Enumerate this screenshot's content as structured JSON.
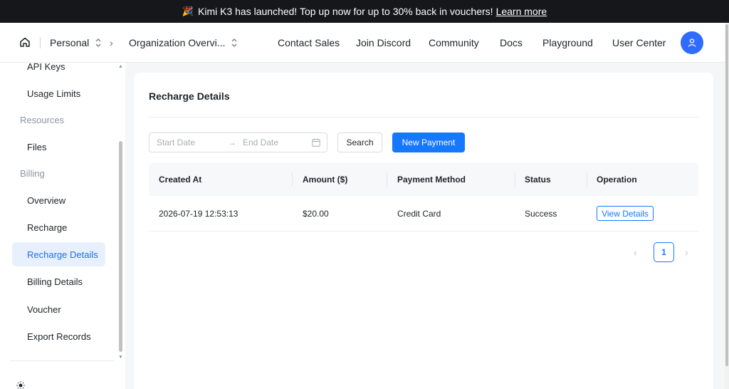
{
  "banner": {
    "emoji": "🎉",
    "message": "Kimi K3 has launched! Top up now for up to 30% back in vouchers!",
    "link_label": "Learn more"
  },
  "topnav": {
    "workspace": "Personal",
    "organization": "Organization Overvi...",
    "links": [
      "Contact Sales",
      "Join Discord",
      "Community",
      "Docs",
      "Playground",
      "User Center"
    ]
  },
  "sidebar": {
    "items_top": [
      "API Keys",
      "Usage Limits"
    ],
    "groups": [
      "Resources",
      "Billing"
    ],
    "resources_items": [
      "Files"
    ],
    "billing_items": [
      "Overview",
      "Recharge",
      "Recharge Details",
      "Billing Details",
      "Voucher",
      "Export Records"
    ],
    "active_item": "Recharge Details"
  },
  "main": {
    "title": "Recharge Details",
    "filters": {
      "start_placeholder": "Start Date",
      "arrow": "→",
      "end_placeholder": "End Date",
      "search_label": "Search",
      "new_payment_label": "New Payment"
    },
    "table": {
      "columns": [
        "Created At",
        "Amount ($)",
        "Payment Method",
        "Status",
        "Operation"
      ],
      "rows": [
        {
          "created_at": "2026-07-19 12:53:13",
          "amount": "$20.00",
          "method": "Credit Card",
          "status": "Success",
          "operation": "View Details"
        }
      ]
    },
    "pagination": {
      "prev": "‹",
      "current": "1",
      "next": "›"
    }
  },
  "colors": {
    "accent": "#1677ff",
    "active_bg": "#e8f0fe",
    "banner_bg": "#15171a"
  }
}
